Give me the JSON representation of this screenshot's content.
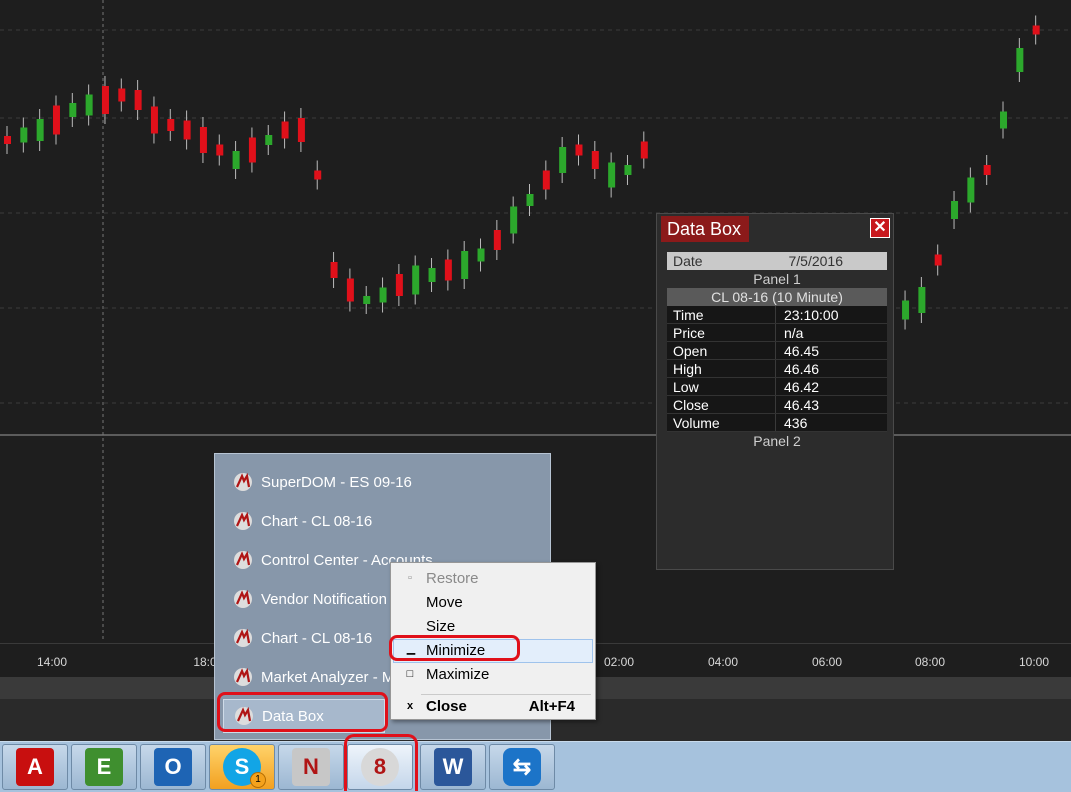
{
  "chart": {
    "time_labels": [
      "14:00",
      "18:0",
      "02:00",
      "04:00",
      "06:00",
      "08:00",
      "10:00"
    ],
    "colors": {
      "background": "#1e1e1e",
      "up": "#2ca82c",
      "down": "#e0101a",
      "grid": "#3c3c3c"
    }
  },
  "data_box": {
    "title": "Data Box",
    "close_glyph": "✕",
    "date_label": "Date",
    "date_value": "7/5/2016",
    "panel1": "Panel 1",
    "instrument": "CL 08-16 (10 Minute)",
    "rows": [
      {
        "label": "Time",
        "value": "23:10:00"
      },
      {
        "label": "Price",
        "value": "n/a"
      },
      {
        "label": "Open",
        "value": "46.45"
      },
      {
        "label": "High",
        "value": "46.46"
      },
      {
        "label": "Low",
        "value": "46.42"
      },
      {
        "label": "Close",
        "value": "46.43"
      },
      {
        "label": "Volume",
        "value": "436"
      }
    ],
    "panel2": "Panel 2"
  },
  "jump_list": {
    "items": [
      {
        "label": "SuperDOM - ES 09-16"
      },
      {
        "label": "Chart - CL 08-16"
      },
      {
        "label": "Control Center - Accounts"
      },
      {
        "label": "Vendor Notification"
      },
      {
        "label": "Chart - CL 08-16"
      },
      {
        "label": "Market Analyzer - M"
      },
      {
        "label": "Data Box"
      }
    ]
  },
  "context_menu": {
    "items": [
      {
        "label": "Restore",
        "icon": "restore-icon",
        "glyph": "▫",
        "disabled": true
      },
      {
        "label": "Move",
        "icon": "",
        "glyph": "",
        "disabled": false
      },
      {
        "label": "Size",
        "icon": "",
        "glyph": "",
        "disabled": false
      },
      {
        "label": "Minimize",
        "icon": "minimize-icon",
        "glyph": "▁",
        "disabled": false
      },
      {
        "label": "Maximize",
        "icon": "maximize-icon",
        "glyph": "□",
        "disabled": false
      }
    ],
    "close": {
      "label": "Close",
      "shortcut": "Alt+F4",
      "glyph": "x"
    }
  },
  "taskbar": {
    "apps": [
      {
        "name": "adobe-reader",
        "glyph": "A",
        "color": "#c80f0f"
      },
      {
        "name": "evernote",
        "glyph": "E",
        "color": "#3f8f2f"
      },
      {
        "name": "outlook",
        "glyph": "O",
        "color": "#1e64b4"
      },
      {
        "name": "skype",
        "glyph": "S",
        "color": "#12a5e6",
        "badge": "1"
      },
      {
        "name": "ninjatrader-7",
        "glyph": "N",
        "color": "#c7c7c7"
      },
      {
        "name": "ninjatrader-8",
        "glyph": "8",
        "color": "#d8d8d8"
      },
      {
        "name": "word",
        "glyph": "W",
        "color": "#2b579a"
      },
      {
        "name": "teamviewer",
        "glyph": "⇆",
        "color": "#1c74c8"
      }
    ]
  }
}
